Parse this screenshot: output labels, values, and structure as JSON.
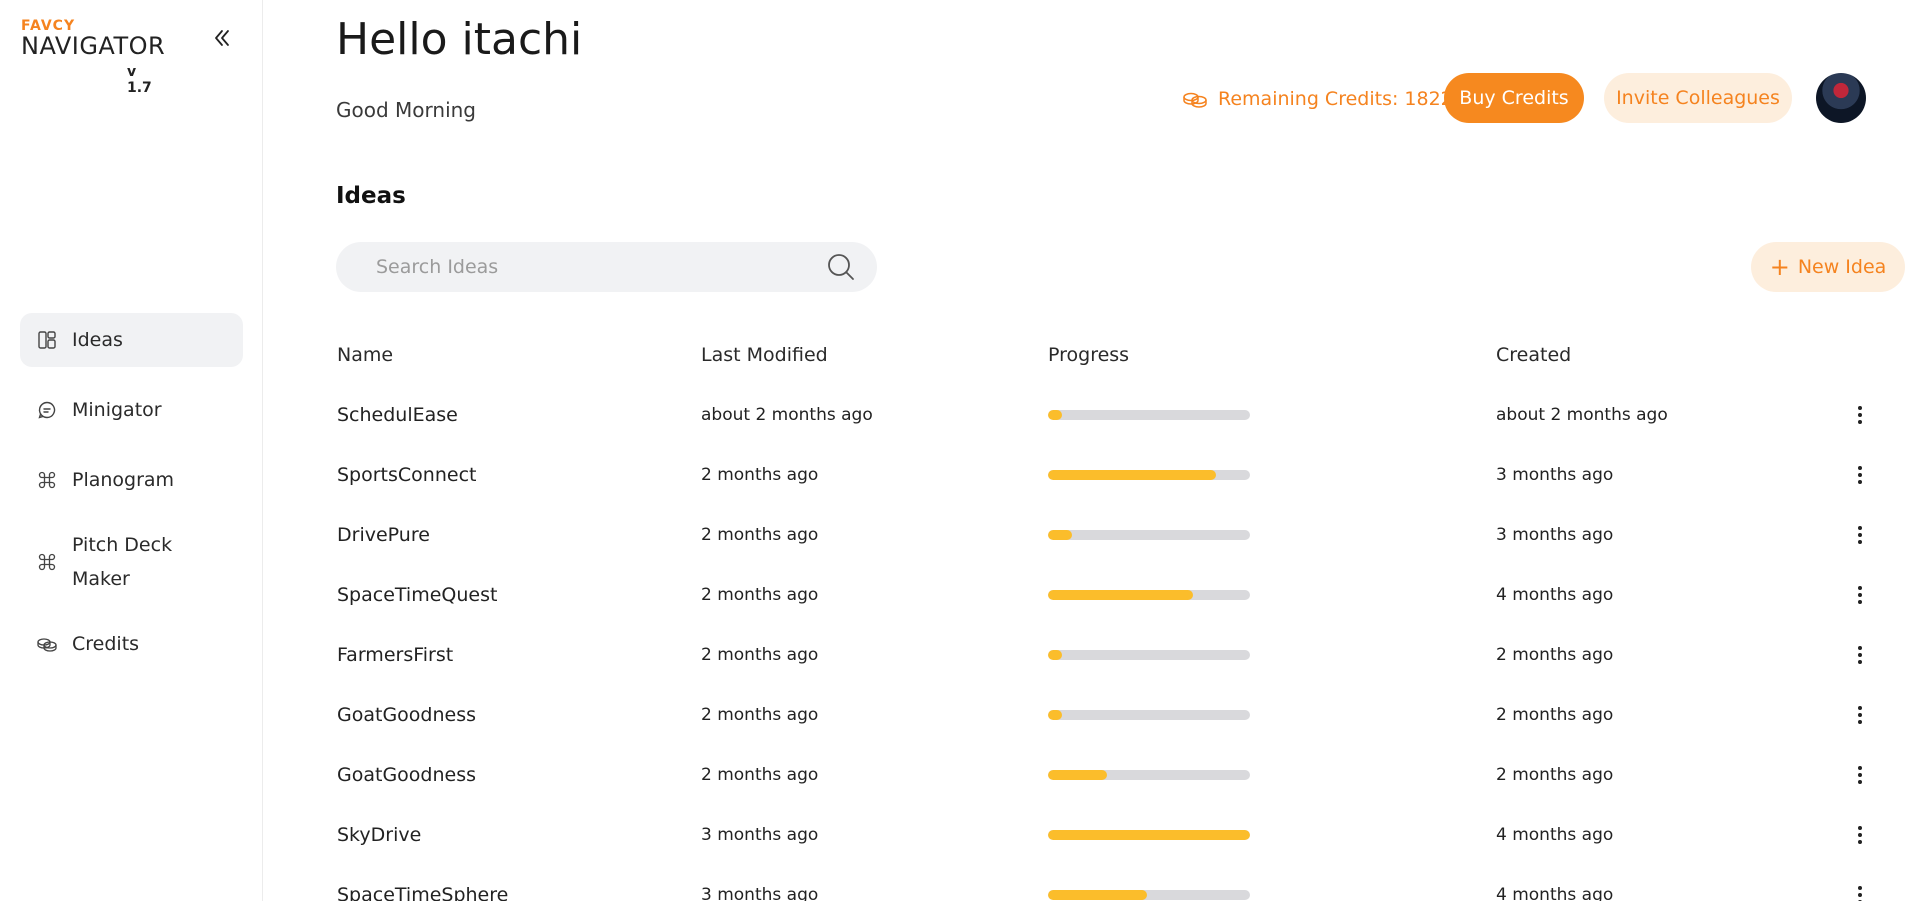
{
  "brand": {
    "tag": "FAVCY",
    "name": "NAVIGATOR",
    "version": "v 1.7"
  },
  "sidebar": {
    "items": [
      {
        "label": "Ideas",
        "icon": "layout-grid-icon",
        "active": true
      },
      {
        "label": "Minigator",
        "icon": "chat-bubble-icon",
        "active": false
      },
      {
        "label": "Planogram",
        "icon": "command-icon",
        "active": false
      },
      {
        "label": "Pitch Deck Maker",
        "icon": "command-icon",
        "active": false
      },
      {
        "label": "Credits",
        "icon": "coins-icon",
        "active": false
      }
    ]
  },
  "header": {
    "greeting": "Hello itachi",
    "subgreeting": "Good Morning",
    "credits_text": "Remaining Credits: 1822",
    "buy_credits": "Buy Credits",
    "invite": "Invite Colleagues"
  },
  "ideas": {
    "title": "Ideas",
    "search_placeholder": "Search Ideas",
    "new_idea": "New Idea",
    "columns": {
      "name": "Name",
      "last_modified": "Last Modified",
      "progress": "Progress",
      "created": "Created"
    },
    "rows": [
      {
        "name": "SchedulEase",
        "last_modified": "about 2 months ago",
        "progress": 7,
        "created": "about 2 months ago"
      },
      {
        "name": "SportsConnect",
        "last_modified": "2 months ago",
        "progress": 83,
        "created": "3 months ago"
      },
      {
        "name": "DrivePure",
        "last_modified": "2 months ago",
        "progress": 12,
        "created": "3 months ago"
      },
      {
        "name": "SpaceTimeQuest",
        "last_modified": "2 months ago",
        "progress": 72,
        "created": "4 months ago"
      },
      {
        "name": "FarmersFirst",
        "last_modified": "2 months ago",
        "progress": 7,
        "created": "2 months ago"
      },
      {
        "name": "GoatGoodness",
        "last_modified": "2 months ago",
        "progress": 7,
        "created": "2 months ago"
      },
      {
        "name": "GoatGoodness",
        "last_modified": "2 months ago",
        "progress": 29,
        "created": "2 months ago"
      },
      {
        "name": "SkyDrive",
        "last_modified": "3 months ago",
        "progress": 100,
        "created": "4 months ago"
      },
      {
        "name": "SpaceTimeSphere",
        "last_modified": "3 months ago",
        "progress": 49,
        "created": "4 months ago"
      }
    ]
  },
  "colors": {
    "accent": "#f6891f",
    "accent_soft": "#fdeedd",
    "progress_fill": "#fbbd2b",
    "progress_track": "#d9d9dc"
  }
}
